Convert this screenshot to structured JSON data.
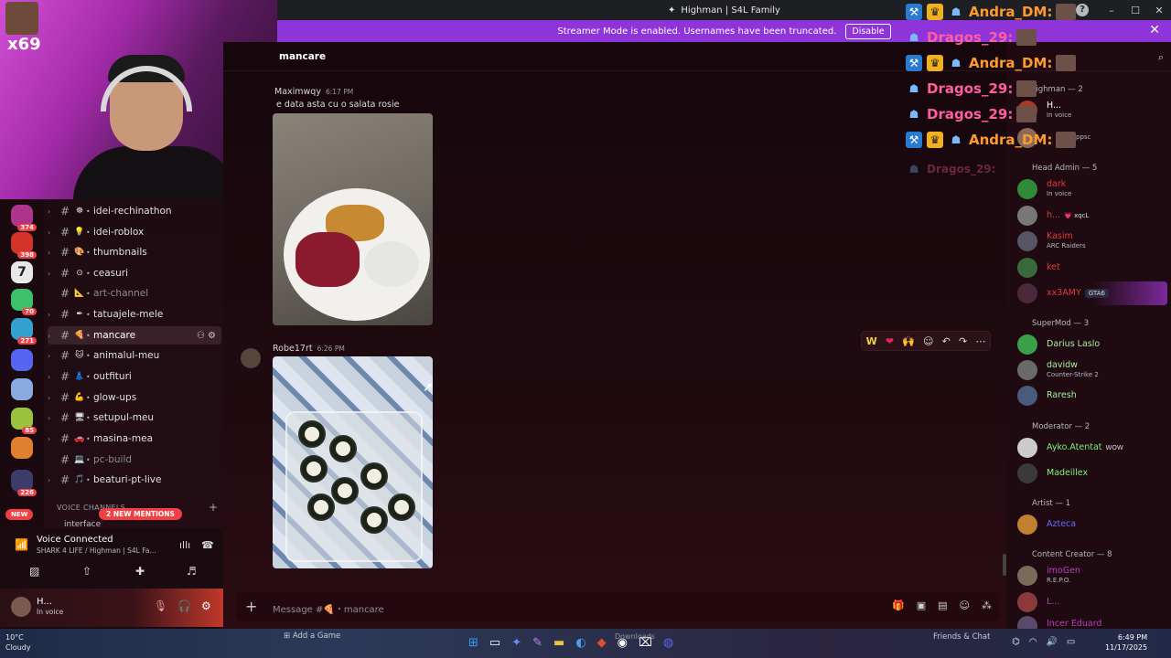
{
  "window": {
    "title": "Highman | S4L Family",
    "icon": "discord-logo-icon",
    "help": "?",
    "controls": [
      "–",
      "☐",
      "✕"
    ]
  },
  "banner": {
    "text": "Streamer Mode is enabled. Usernames have been truncated.",
    "button": "Disable",
    "close": "✕"
  },
  "webcam": {
    "badge": "x69"
  },
  "servers": [
    {
      "count": "374",
      "color": "#b0358a"
    },
    {
      "count": "398",
      "color": "#d2332b"
    },
    {
      "count": "",
      "color": "#e8e8e8",
      "glyph": "7"
    },
    {
      "count": "70",
      "color": "#3cc06b"
    },
    {
      "count": "271",
      "color": "#35a1d0"
    },
    {
      "count": "",
      "color": "#5865f2"
    },
    {
      "count": "",
      "color": "#88aadd"
    },
    {
      "count": "85",
      "color": "#9ac23c"
    },
    {
      "count": "",
      "color": "#e08030"
    },
    {
      "count": "226",
      "color": "#3c3c6a"
    }
  ],
  "new_label": "NEW",
  "channels": [
    {
      "emoji": "☸",
      "name": "idei-rechinathon"
    },
    {
      "emoji": "💡",
      "name": "idei-roblox"
    },
    {
      "emoji": "🎨",
      "name": "thumbnails"
    },
    {
      "emoji": "⊙",
      "name": "ceasuri"
    },
    {
      "emoji": "📐",
      "name": "art-channel"
    },
    {
      "emoji": "✒",
      "name": "tatuajele-mele"
    },
    {
      "emoji": "🍕",
      "name": "mancare"
    },
    {
      "emoji": "🐱",
      "name": "animalul-meu"
    },
    {
      "emoji": "👗",
      "name": "outfituri"
    },
    {
      "emoji": "💪",
      "name": "glow-ups"
    },
    {
      "emoji": "🖥",
      "name": "setupul-meu"
    },
    {
      "emoji": "🚗",
      "name": "masina-mea"
    },
    {
      "emoji": "💻",
      "name": "pc-build"
    },
    {
      "emoji": "🎵",
      "name": "beaturi-pt-live"
    }
  ],
  "voice_header": "VOICE CHANNELS",
  "mentions_pill": "2 NEW MENTIONS",
  "partial_channel": "interface",
  "voice": {
    "status": "Voice Connected",
    "sub": "SHARK 4 LIFE / Highman | S4L Fa..."
  },
  "user": {
    "name": "H...",
    "status": "In voice"
  },
  "chat": {
    "channel": "mancare",
    "messages": [
      {
        "author": "Maximwqy",
        "time": "6:17 PM",
        "text": "e data asta cu o salata rosie"
      },
      {
        "author": "Robe17rt",
        "time": "6:26 PM",
        "text": ""
      }
    ],
    "composer_placeholder": "Message #🍕・mancare",
    "composer_plus": "+"
  },
  "hover_toolbar": [
    "W",
    "❤",
    "🙌",
    "☺",
    "↶",
    "↷",
    "⋯"
  ],
  "overlay": [
    {
      "name": "Andra_DM:",
      "color": "orange"
    },
    {
      "name": "Dragos_29:",
      "color": "pink"
    },
    {
      "name": "Andra_DM:",
      "color": "orange"
    },
    {
      "name": "Dragos_29:",
      "color": "pink"
    },
    {
      "name": "Dragos_29:",
      "color": "pink"
    },
    {
      "name": "Andra_DM:",
      "color": "orange"
    },
    {
      "name": "Dragos_29:",
      "color": "pink"
    }
  ],
  "members": {
    "search": "Search",
    "groups": [
      {
        "label": "Highman — 2"
      },
      {
        "label": "Head Admin — 5"
      },
      {
        "label": "SuperMod — 3"
      },
      {
        "label": "Moderator — 2"
      },
      {
        "label": "Artist — 1"
      },
      {
        "label": "Content Creator — 8"
      }
    ],
    "items": [
      {
        "name": "H...",
        "status": "In voice",
        "color": "#ffffff",
        "tag": ""
      },
      {
        "name": "",
        "status": "ppsc",
        "color": "#ffffff",
        "tag": ""
      },
      {
        "name": "dark",
        "status": "In voice",
        "color": "#e03c3c",
        "tag": ""
      },
      {
        "name": "h...",
        "status": "",
        "color": "#e03c3c",
        "tag": "💗 xqcL"
      },
      {
        "name": "Kasim",
        "status": "ARC Raiders",
        "color": "#e03c3c",
        "tag": ""
      },
      {
        "name": "ket",
        "status": "",
        "color": "#e03c3c",
        "tag": ""
      },
      {
        "name": "xx3AMY",
        "status": "",
        "color": "#e03c3c",
        "tag": "GTA6"
      },
      {
        "name": "Darius Laslo",
        "status": "",
        "color": "#a8f0a0",
        "tag": ""
      },
      {
        "name": "davidw",
        "status": "Counter-Strike 2",
        "color": "#a8f0a0",
        "tag": ""
      },
      {
        "name": "Raresh",
        "status": "",
        "color": "#a8f0a0",
        "tag": ""
      },
      {
        "name": "Ayko.Atentat",
        "status": "",
        "color": "#7df07d",
        "tag": "WOW"
      },
      {
        "name": "Madeillex",
        "status": "",
        "color": "#7df07d",
        "tag": ""
      },
      {
        "name": "Azteca",
        "status": "",
        "color": "#6b6bff",
        "tag": ""
      },
      {
        "name": "imoGen",
        "status": "R.E.P.O.",
        "color": "#c03cc0",
        "tag": ""
      },
      {
        "name": "L...",
        "status": "",
        "color": "#c03cc0",
        "tag": ""
      },
      {
        "name": "Incer Eduard",
        "status": "",
        "color": "#c03cc0",
        "tag": ""
      }
    ]
  },
  "taskbar": {
    "weather_temp": "10°C",
    "weather_desc": "Cloudy",
    "add_game": "Add a Game",
    "downloads": "Downloads",
    "friends": "Friends & Chat",
    "time": "6:49 PM",
    "date": "11/17/2025"
  }
}
